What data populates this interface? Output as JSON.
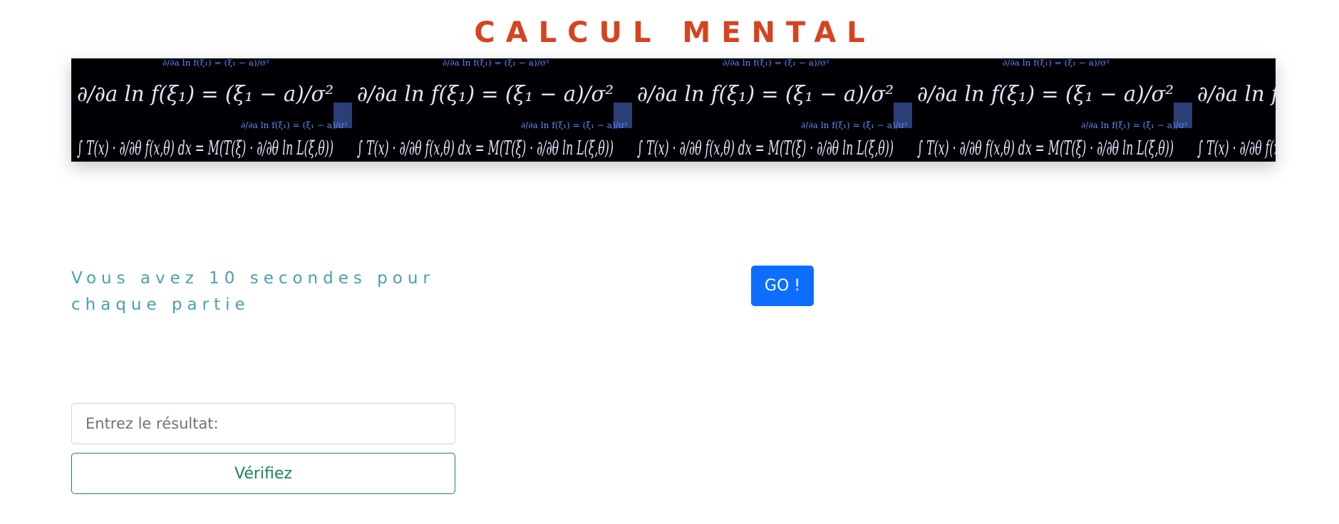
{
  "header": {
    "title": "CALCUL MENTAL"
  },
  "banner": {
    "formula_top": "∂/∂a ln f(ξ₁) = (ξ₁ − a)/σ²",
    "formula_bottom": "∫ T(x) · ∂/∂θ f(x,θ) dx = M(T(ξ) · ∂/∂θ ln L(ξ,θ))",
    "colors": {
      "background": "#000004",
      "ink": "#dfe8ff",
      "glow": "#5b8cff"
    }
  },
  "game": {
    "instructions": "Vous avez 10 secondes pour chaque partie",
    "go_label": "GO !"
  },
  "answer": {
    "placeholder": "Entrez le résultat:",
    "value": "",
    "verify_label": "Vérifiez"
  },
  "colors": {
    "title": "#d7421f",
    "instructions": "#4a9fae",
    "primary": "#0d6efd",
    "success": "#198754"
  }
}
